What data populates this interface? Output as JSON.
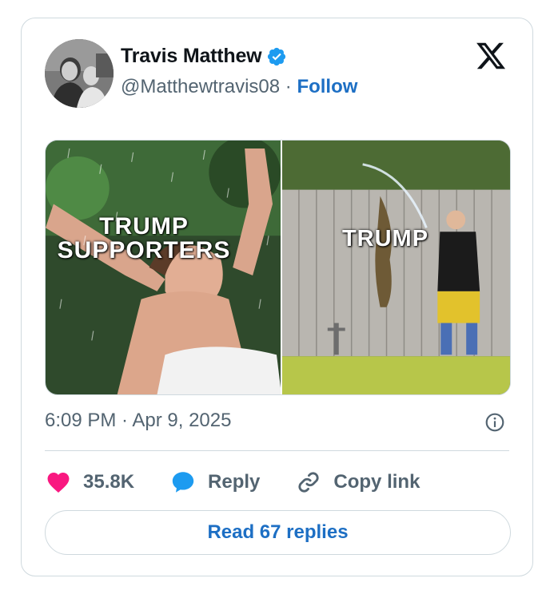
{
  "author": {
    "name": "Travis Matthew",
    "handle": "@Matthewtravis08",
    "separator": " · ",
    "follow_label": "Follow",
    "verified": true
  },
  "media": {
    "left_caption_line1": "TRUMP",
    "left_caption_line2": "SUPPORTERS",
    "right_caption": "TRUMP"
  },
  "timestamp": "6:09 PM · Apr 9, 2025",
  "actions": {
    "like_count": "35.8K",
    "reply_label": "Reply",
    "copy_label": "Copy link"
  },
  "read_replies_label": "Read 67 replies",
  "icons": {
    "verified": "verified-badge-icon",
    "brand": "x-logo-icon",
    "info": "info-icon",
    "like": "heart-icon",
    "reply": "speech-bubble-icon",
    "copy": "link-icon"
  },
  "colors": {
    "accent": "#1d6fc4",
    "like": "#f91880",
    "reply": "#1d9bf0",
    "secondary_text": "#536471",
    "border": "#cfd9de"
  }
}
